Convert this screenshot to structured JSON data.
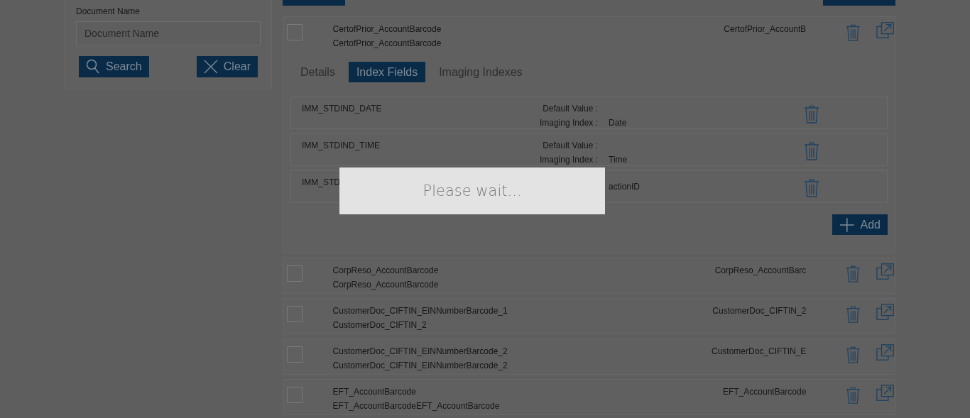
{
  "search_panel": {
    "label": "Document Name",
    "placeholder": "Document Name",
    "buttons": [
      {
        "label": "Search",
        "kind": "search"
      },
      {
        "label": "Clear",
        "kind": "clear"
      }
    ]
  },
  "documents": [
    {
      "checked": false,
      "name": "CertofPrior_AccountBarcode",
      "description": "CertofPrior_AccountBarcode",
      "code": "CertofPrior_AccountB",
      "expanded": true,
      "tabs": [
        {
          "label": "Details",
          "selected": false
        },
        {
          "label": "Index Fields",
          "selected": true
        },
        {
          "label": "Imaging Indexes",
          "selected": false
        }
      ],
      "index_fields": [
        {
          "name": "IMM_STDIND_DATE",
          "default_value_label": "Default Value :",
          "imaging_index_label": "Imaging Index :",
          "imaging_index": "Date"
        },
        {
          "name": "IMM_STDIND_TIME",
          "default_value_label": "Default Value :",
          "imaging_index_label": "Imaging Index :",
          "imaging_index": "Time"
        },
        {
          "name": "IMM_STD",
          "imaging_index": "actionID"
        }
      ],
      "add_label": "Add"
    },
    {
      "checked": false,
      "name": "CorpReso_AccountBarcode",
      "description": "CorpReso_AccountBarcode",
      "code": "CorpReso_AccountBarc",
      "expanded": false
    },
    {
      "checked": false,
      "name": "CustomerDoc_CIFTIN_EINNumberBarcode_1",
      "description": "CustomerDoc_CIFTIN_2",
      "code": "CustomerDoc_CIFTIN_2",
      "expanded": false
    },
    {
      "checked": false,
      "name": "CustomerDoc_CIFTIN_EINNumberBarcode_2",
      "description": "CustomerDoc_CIFTIN_EINNumberBarcode_2",
      "code": "CustomerDoc_CIFTIN_E",
      "expanded": false
    },
    {
      "checked": false,
      "name": "EFT_AccountBarcode",
      "description": "EFT_AccountBarcodeEFT_AccountBarcode",
      "code": "EFT_AccountBarcode",
      "expanded": false
    }
  ],
  "loading": {
    "message": "Please wait..."
  }
}
